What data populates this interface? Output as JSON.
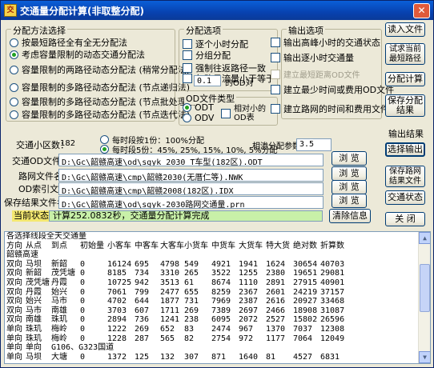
{
  "window": {
    "title": "交通量分配计算(非取整分配)",
    "icon": "app-icon"
  },
  "method_group": {
    "title": "分配方法选择",
    "options": [
      "按最短路径全有全无分配法",
      "考虑容量限制的动态交通分配法",
      "容量限制的两路径动态分配法 (稍常分配法)",
      "容量限制的多路径动态分配法 (节点递归法)",
      "容量限制的多路径动态分配法 (节点批处理法)",
      "容量限制的多路径动态分配法 (节点迭代法)"
    ],
    "selected_index": 1
  },
  "options_group": {
    "title": "分配选项",
    "items": [
      {
        "label": "逐个小时分配",
        "checked": false
      },
      {
        "label": "分组分配",
        "checked": false
      },
      {
        "label": "强制往返路径一致",
        "checked": false
      },
      {
        "label": "忽略日流量小于等于",
        "checked": false
      }
    ],
    "threshold_value": "0.1",
    "threshold_unit": "的OD对"
  },
  "od_type_group": {
    "title": "OD文件类型",
    "options": [
      "ODT",
      "ODV"
    ],
    "selected_index": 0,
    "relative_label": "相对小的OD表",
    "relative_checked": false
  },
  "output_group": {
    "title": "输出选项",
    "items": [
      {
        "label": "输出高峰小时的交通状态",
        "checked": false,
        "disabled": false
      },
      {
        "label": "输出逐小时交通量",
        "checked": false,
        "disabled": false
      },
      {
        "label": "建立最短距离OD文件",
        "checked": false,
        "disabled": true
      },
      {
        "label": "建立最少时间或费用OD文件",
        "checked": false,
        "disabled": false
      },
      {
        "label": "建立路网的时间和费用文件",
        "checked": false,
        "disabled": false
      }
    ]
  },
  "zones": {
    "label": "交通小区数：",
    "value": "182"
  },
  "steps": {
    "options": [
      "每时段按1份：100%分配",
      "每时段5份：45%, 25%, 15%, 10%, 5%分配"
    ],
    "selected_index": 1
  },
  "distribution_param": {
    "label": "相渗分配参数",
    "value": "3.5"
  },
  "files": [
    {
      "label": "交通OD文件名",
      "value": "D:\\Gc\\韶赣高速\\od\\sgyk_2030_T车型(182区).ODT",
      "browse": "浏 览"
    },
    {
      "label": "路网文件名",
      "value": "D:\\Gc\\韶赣高速\\cmp\\韶赣2030(无厝仁等).NWK",
      "browse": "浏 览"
    },
    {
      "label": "OD索引文件",
      "value": "D:\\Gc\\韶赣高速\\cmp\\韶赣2008(182区).IDX",
      "browse": "浏 览"
    },
    {
      "label": "保存结果文件名",
      "value": "D:\\Gc\\韶赣高速\\od\\sgyk-2030路网交通量.prn",
      "browse": "浏 览"
    }
  ],
  "status": {
    "label": "当前状态：",
    "text": "计算252.0832秒，交通量分配计算完成",
    "clear_button": "清除信息"
  },
  "side_buttons": {
    "read_file": "读入文件",
    "trial_shortest": "试求当前最短路径",
    "distribute": "分配计算",
    "save_results": "保存分配结果",
    "output_results_label": "输出结果",
    "select_output": "选择输出",
    "save_network_results": "保存路网结果文件",
    "traffic_state": "交通状态",
    "close": "关 闭"
  },
  "output": {
    "heading": "各选择线段全天交通量",
    "columns": [
      "方向",
      "从点",
      "到点",
      "初始量",
      "小客车",
      "中客车",
      "大客车",
      "小货车",
      "中货车",
      "大货车",
      "特大货",
      "绝对数",
      "折算数"
    ],
    "section": "韶赣高速",
    "rows": [
      [
        "双向",
        "马坝",
        "新韶",
        "0",
        "16124",
        "695",
        "4798",
        "549",
        "4921",
        "1941",
        "1624",
        "30654",
        "40703"
      ],
      [
        "双向",
        "新韶",
        "茂凭塘",
        "0",
        "8185",
        "734",
        "3310",
        "265",
        "3522",
        "1255",
        "2380",
        "19651",
        "29081"
      ],
      [
        "双向",
        "茂凭塘",
        "丹霞",
        "0",
        "10725",
        "942",
        "3513",
        "61",
        "8674",
        "1110",
        "2891",
        "27915",
        "40901"
      ],
      [
        "双向",
        "丹霞",
        "始兴",
        "0",
        "7061",
        "799",
        "2477",
        "655",
        "8259",
        "2367",
        "2601",
        "24219",
        "37157"
      ],
      [
        "双向",
        "始兴",
        "马市",
        "0",
        "4702",
        "644",
        "1877",
        "731",
        "7969",
        "2387",
        "2616",
        "20927",
        "33468"
      ],
      [
        "双向",
        "马市",
        "南雄",
        "0",
        "3703",
        "607",
        "1711",
        "269",
        "7389",
        "2697",
        "2466",
        "18908",
        "31087"
      ],
      [
        "双向",
        "南雄",
        "珠玑",
        "0",
        "2894",
        "736",
        "1241",
        "238",
        "6095",
        "2072",
        "2527",
        "15802",
        "26596"
      ],
      [
        "单向",
        "珠玑",
        "梅岭",
        "0",
        "1222",
        "269",
        "652",
        "83",
        "2474",
        "967",
        "1370",
        "7037",
        "12308"
      ],
      [
        "单向",
        "珠玑",
        "梅岭",
        "0",
        "1228",
        "287",
        "565",
        "82",
        "2754",
        "972",
        "1177",
        "7064",
        "12049"
      ],
      [
        "单向",
        "单向",
        "G106、G323国道",
        "",
        "",
        "",
        "",
        "",
        "",
        "",
        "",
        "",
        ""
      ],
      [
        "单向",
        "马坝",
        "大塘",
        "0",
        "1372",
        "125",
        "132",
        "307",
        "871",
        "1640",
        "81",
        "4527",
        "6831"
      ]
    ]
  }
}
